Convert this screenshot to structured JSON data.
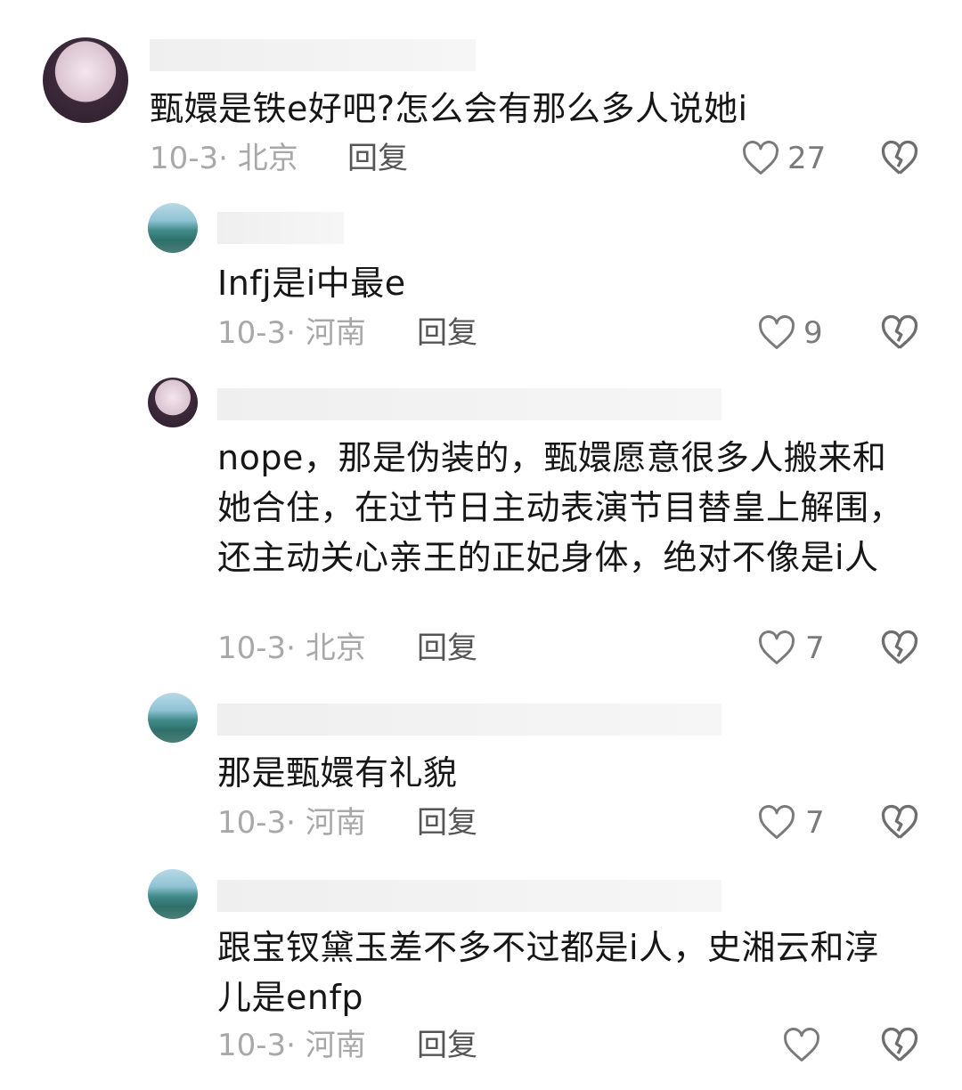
{
  "comments": [
    {
      "text": "甄嬛是铁e好吧?怎么会有那么多人说她i",
      "date_location": "10-3· 北京",
      "reply_label": "回复",
      "likes": "27"
    },
    {
      "text": "Infj是i中最e",
      "date_location": "10-3· 河南",
      "reply_label": "回复",
      "likes": "9"
    },
    {
      "text": "nope，那是伪装的，甄嬛愿意很多人搬来和她合住，在过节日主动表演节目替皇上解围，还主动关心亲王的正妃身体，绝对不像是i人",
      "date_location": "10-3· 北京",
      "reply_label": "回复",
      "likes": "7"
    },
    {
      "text": "那是甄嬛有礼貌",
      "date_location": "10-3· 河南",
      "reply_label": "回复",
      "likes": "7"
    },
    {
      "text": "跟宝钗黛玉差不多不过都是i人，史湘云和淳儿是enfp",
      "date_location": "10-3· 河南",
      "reply_label": "回复",
      "likes": ""
    }
  ]
}
